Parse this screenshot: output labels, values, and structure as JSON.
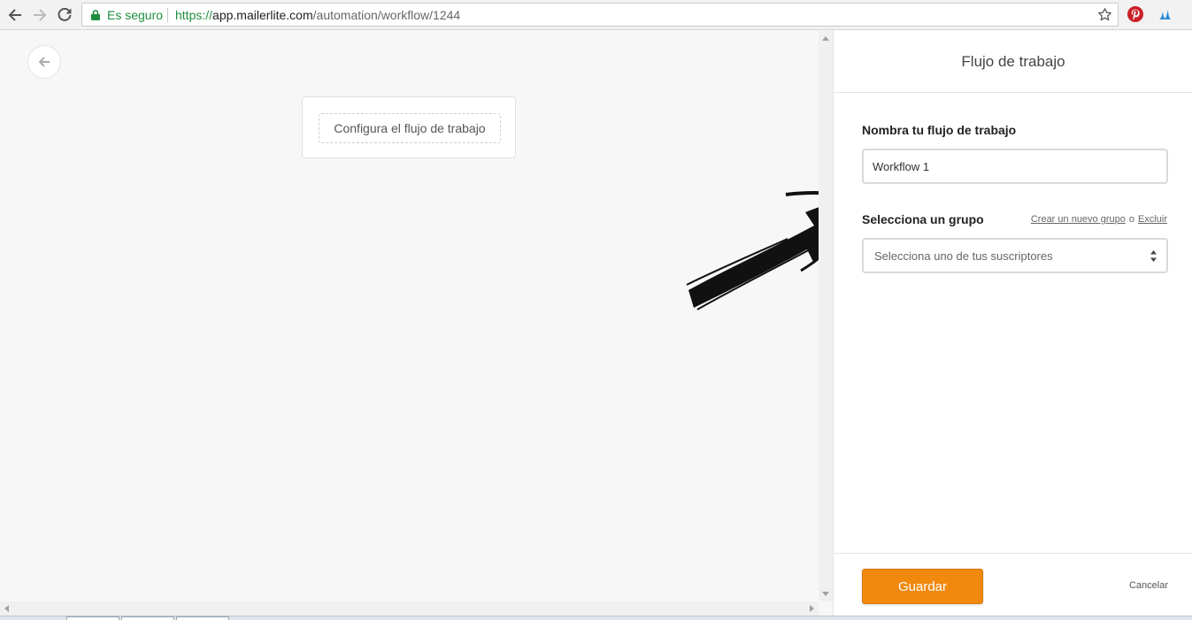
{
  "browser": {
    "secure_label": "Es seguro",
    "url_scheme": "https://",
    "url_host": "app.mailerlite.com",
    "url_path": "/automation/workflow/1244"
  },
  "canvas": {
    "start_node_label": "Configura el flujo de trabajo"
  },
  "panel": {
    "title": "Flujo de trabajo",
    "name_label": "Nombra tu flujo de trabajo",
    "name_value": "Workflow 1",
    "group_label": "Selecciona un grupo",
    "create_group_link": "Crear un nuevo grupo",
    "or_text": "o",
    "exclude_link": "Excluir",
    "group_placeholder": "Selecciona uno de tus suscriptores",
    "save_label": "Guardar",
    "cancel_label": "Cancelar"
  },
  "colors": {
    "accent": "#f0890e",
    "secure_green": "#1e8e3e",
    "pinterest": "#cb2027"
  },
  "icons": [
    "back-arrow-icon",
    "forward-arrow-icon",
    "reload-icon",
    "lock-icon",
    "star-icon",
    "pinterest-icon",
    "extension-icon",
    "circle-back-icon",
    "chevron-updown-icon",
    "hand-drawn-arrow"
  ]
}
